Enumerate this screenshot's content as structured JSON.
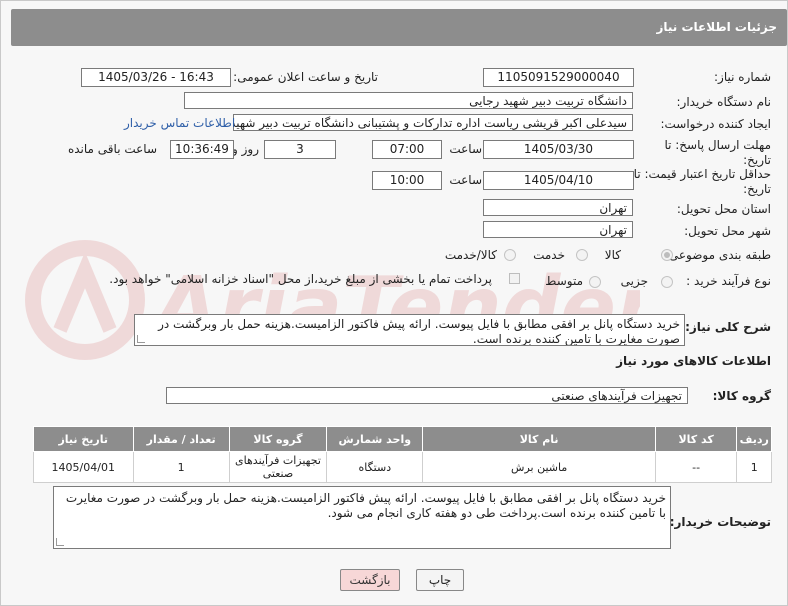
{
  "header": {
    "title": "جزئیات اطلاعات نیاز"
  },
  "form": {
    "need_number_label": "شماره نیاز:",
    "need_number": "1105091529000040",
    "announce_label": "تاریخ و ساعت اعلان عمومی:",
    "announce_value": "1405/03/26 - 16:43",
    "buyer_org_label": "نام دستگاه خریدار:",
    "buyer_org": "دانشگاه تربیت دبیر شهید رجایی",
    "creator_label": "ایجاد کننده درخواست:",
    "creator": "سیدعلی اکبر قریشی ریاست اداره تدارکات و پشتیبانی دانشگاه تربیت دبیر شهید رجایی",
    "contact_link": "اطلاعات تماس خریدار",
    "deadline_label": "مهلت ارسال پاسخ: تا تاریخ:",
    "deadline_date": "1405/03/30",
    "time_label": "ساعت",
    "deadline_time": "07:00",
    "days_value": "3",
    "days_label": "روز و",
    "remaining_time": "10:36:49",
    "remaining_label": "ساعت باقی مانده",
    "validity_label": "حداقل تاریخ اعتبار قیمت: تا تاریخ:",
    "validity_date": "1405/04/10",
    "validity_time": "10:00",
    "province_label": "استان محل تحویل:",
    "province": "تهران",
    "city_label": "شهر محل تحویل:",
    "city": "تهران",
    "category_label": "طبقه بندی موضوعی:",
    "category_options": [
      "کالا",
      "خدمت",
      "کالا/خدمت"
    ],
    "purchase_type_label": "نوع فرآیند خرید :",
    "purchase_options": [
      "جزیی",
      "متوسط"
    ],
    "payment_note": "پرداخت تمام یا بخشی از مبلغ خرید،از محل \"اسناد خزانه اسلامی\" خواهد بود."
  },
  "description": {
    "label": "شرح کلی نیاز:",
    "text": "خرید دستگاه پانل بر افقی مطابق با فایل پیوست. ارائه پیش فاکتور الزامیست.هزینه حمل بار وبرگشت در صورت مغایرت با تامین کننده برنده است."
  },
  "goods": {
    "section_title": "اطلاعات کالاهای مورد نیاز",
    "group_label": "گروه کالا:",
    "group_value": "تجهیزات فرآیندهای صنعتی",
    "columns": [
      "ردیف",
      "کد کالا",
      "نام کالا",
      "واحد شمارش",
      "گروه کالا",
      "تعداد / مقدار",
      "تاریخ نیاز"
    ],
    "rows": [
      [
        "1",
        "--",
        "ماشین برش",
        "دستگاه",
        "تجهیزات فرآیندهای صنعتی",
        "1",
        "1405/04/01"
      ]
    ]
  },
  "buyer_notes": {
    "label": "توضیحات خریدار:",
    "text": "خرید دستگاه پانل بر افقی مطابق با فایل پیوست. ارائه پیش فاکتور الزامیست.هزینه حمل بار وبرگشت در صورت مغایرت با تامین کننده برنده است.پرداخت طی دو هفته کاری انجام می شود."
  },
  "buttons": {
    "print": "چاپ",
    "back": "بازگشت"
  },
  "watermark": {
    "text": "AriaTender.neT"
  },
  "colors": {
    "header_bg": "#8d8d8d",
    "back_button_bg": "#f7d7d7",
    "link": "#2f5fa8"
  }
}
